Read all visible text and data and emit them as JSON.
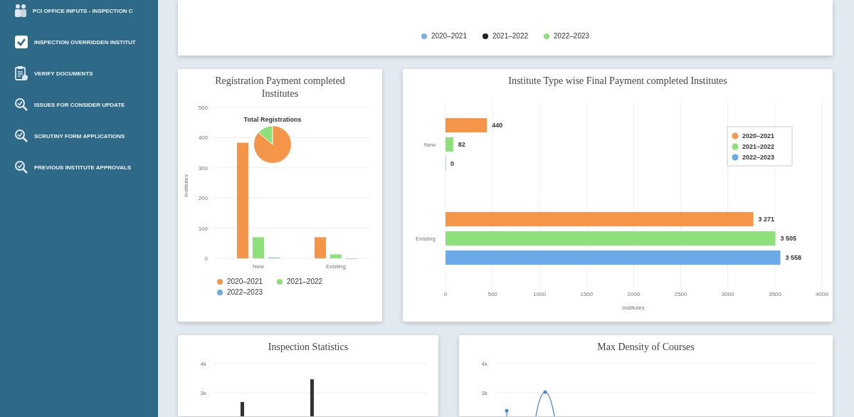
{
  "sidebar": {
    "items": [
      {
        "kind": "people",
        "label": "PCI OFFICE INPUTS - INSPECTION C"
      },
      {
        "kind": "checkbox",
        "label": "INSPECTION OVERRIDDEN INSTITUT"
      },
      {
        "kind": "clipboard",
        "label": "VERIFY DOCUMENTS"
      },
      {
        "kind": "search-check",
        "label": "ISSUES FOR CONSIDER UPDATE"
      },
      {
        "kind": "search-check",
        "label": "SCRUTINY FORM APPLICATIONS"
      },
      {
        "kind": "search-check",
        "label": "PREVIOUS INSTITUTE APPROVALS"
      }
    ]
  },
  "summary_legend": [
    {
      "label": "2020–2021",
      "color": "#7fb0e0"
    },
    {
      "label": "2021–2022",
      "color": "#222222"
    },
    {
      "label": "2022–2023",
      "color": "#8ee07a"
    }
  ],
  "registration_chart": {
    "title": "Registration Payment completed Institutes",
    "inset_title": "Total Registrations",
    "chart_data": {
      "type": "bar",
      "ylabel": "Institutes",
      "categories": [
        "New",
        "Existing"
      ],
      "ylim": [
        0,
        500
      ],
      "yticks": [
        0,
        100,
        200,
        300,
        400,
        500
      ],
      "grid": true,
      "series": [
        {
          "name": "2020–2021",
          "color": "#f5954a",
          "values": [
            383,
            70
          ]
        },
        {
          "name": "2021–2022",
          "color": "#8ee07a",
          "values": [
            70,
            13
          ]
        },
        {
          "name": "2022–2023",
          "color": "#6aaae6",
          "values": [
            2,
            0
          ]
        }
      ]
    }
  },
  "final_payment_chart": {
    "title": "Institute Type wise Final Payment completed Institutes",
    "chart_data": {
      "type": "bar",
      "orientation": "horizontal",
      "xlabel": "Institutes",
      "categories": [
        "New",
        "Existing"
      ],
      "xlim": [
        0,
        4000
      ],
      "xticks": [
        0,
        500,
        1000,
        1500,
        2000,
        2500,
        3000,
        3500,
        4000
      ],
      "grid": true,
      "legend": "upper right",
      "data_labels": true,
      "series": [
        {
          "name": "2020–2021",
          "color": "#f5954a",
          "values": [
            440,
            3271
          ]
        },
        {
          "name": "2021–2022",
          "color": "#8ee07a",
          "values": [
            82,
            3505
          ]
        },
        {
          "name": "2022–2023",
          "color": "#6aaae6",
          "values": [
            0,
            3558
          ]
        }
      ]
    }
  },
  "inspection_chart": {
    "title": "Inspection Statistics",
    "tick_labels": [
      "4k",
      "3k"
    ]
  },
  "density_chart": {
    "title": "Max Density of Courses",
    "tick_labels": [
      "4k",
      "3k"
    ]
  }
}
